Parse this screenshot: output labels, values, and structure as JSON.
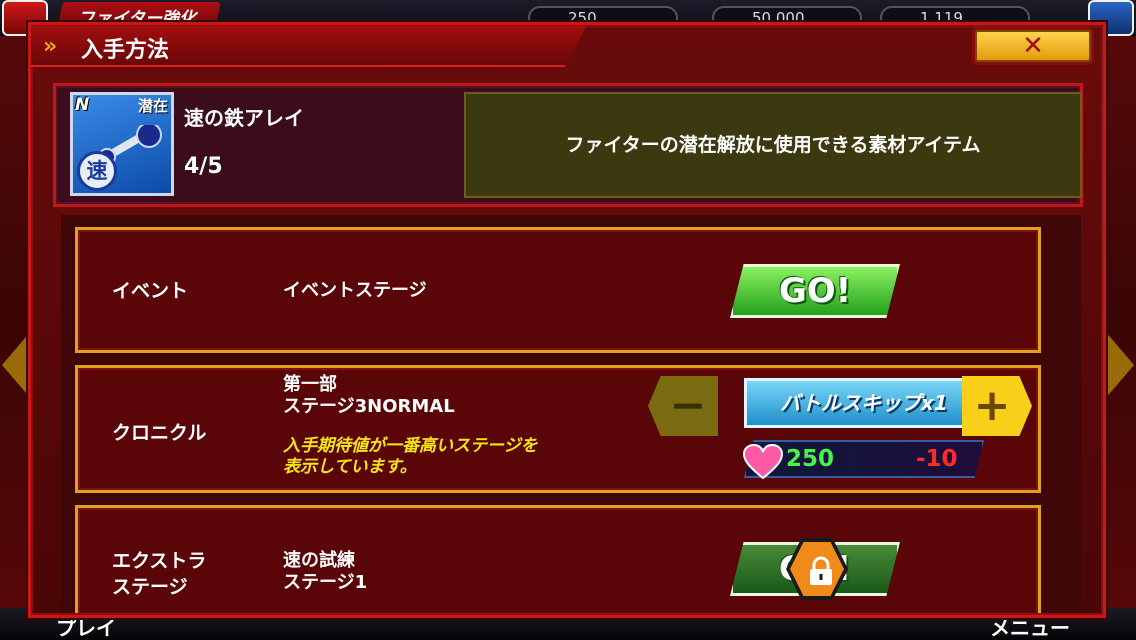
{
  "background": {
    "screen_title": "ファイター強化",
    "stat_values": [
      "250",
      "50,000",
      "1,119"
    ],
    "bottom_left": "プレイ",
    "bottom_right": "メニュー"
  },
  "modal": {
    "title": "入手方法",
    "close_glyph": "✕"
  },
  "item": {
    "rarity": "N",
    "latent_tag": "潜在",
    "badge_glyph": "速",
    "name": "速の鉄アレイ",
    "count": "4/5",
    "description": "ファイターの潜在解放に使用できる素材アイテム"
  },
  "sources": [
    {
      "category": "イベント",
      "detail_lines": [
        "イベントステージ"
      ],
      "action_label": "GO!"
    },
    {
      "category": "クロニクル",
      "detail_lines": [
        "第一部",
        "ステージ3NORMAL"
      ],
      "note_lines": [
        "入手期待値が一番高いステージを",
        "表示しています。"
      ],
      "minus_glyph": "−",
      "plus_glyph": "+",
      "skip_label": "バトルスキップx1",
      "stamina_current": "250",
      "stamina_cost": "-10"
    },
    {
      "category_lines": [
        "エクストラ",
        "ステージ"
      ],
      "detail_lines": [
        "速の試練",
        "ステージ1"
      ],
      "action_label": "GO!",
      "locked": true
    }
  ],
  "colors": {
    "accent_gold": "#e0a01a",
    "go_green": "#22a01c",
    "stamina_green": "#4cf04c",
    "cost_red": "#ff2a2a",
    "note_yellow": "#f8e41a"
  }
}
